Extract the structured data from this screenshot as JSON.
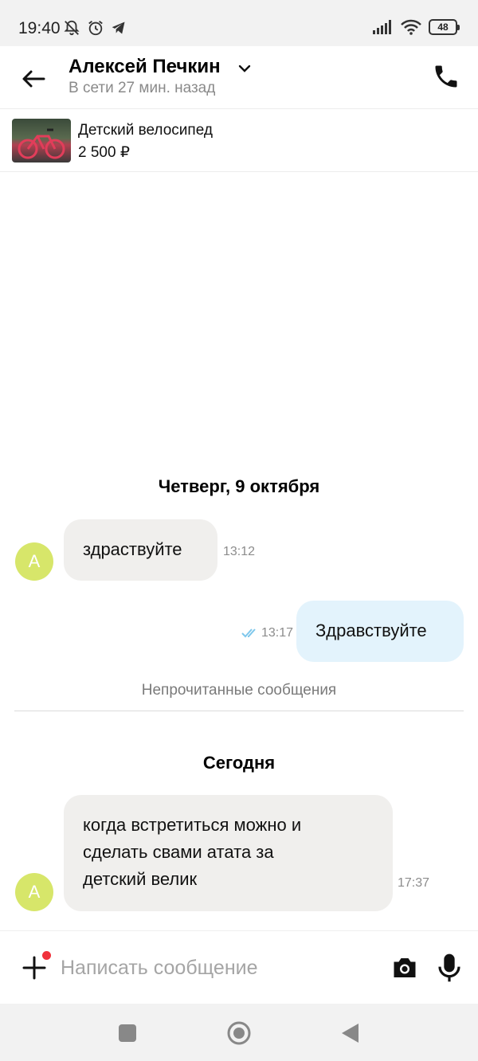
{
  "status_bar": {
    "time": "19:40",
    "battery": "48",
    "icons": [
      "bell-off-icon",
      "alarm-icon",
      "telegram-icon",
      "signal-icon",
      "wifi-icon",
      "battery-icon"
    ]
  },
  "header": {
    "contact_name": "Алексей Печкин",
    "contact_status": "В сети 27 мин. назад"
  },
  "listing": {
    "title": "Детский велосипед",
    "price": "2 500 ₽"
  },
  "chat": {
    "date_thursday": "Четверг, 9 октября",
    "date_today": "Сегодня",
    "unread_label": "Непрочитанные сообщения",
    "messages": [
      {
        "direction": "in",
        "avatar": "А",
        "text": "здраствуйте",
        "time": "13:12"
      },
      {
        "direction": "out",
        "text": "Здравствуйте",
        "time": "13:17",
        "status": "read"
      },
      {
        "direction": "in",
        "avatar": "А",
        "lines": [
          "когда встретиться можно и",
          "сделать свами атата за",
          "детский велик"
        ],
        "time": "17:37"
      }
    ]
  },
  "composer": {
    "placeholder": "Написать сообщение",
    "value": ""
  },
  "colors": {
    "avatar": "#d7e66a",
    "incoming_bubble": "#f0efed",
    "outgoing_bubble": "#e3f3fc",
    "read_check": "#7ec7ec",
    "notification_dot": "#f0323c"
  }
}
